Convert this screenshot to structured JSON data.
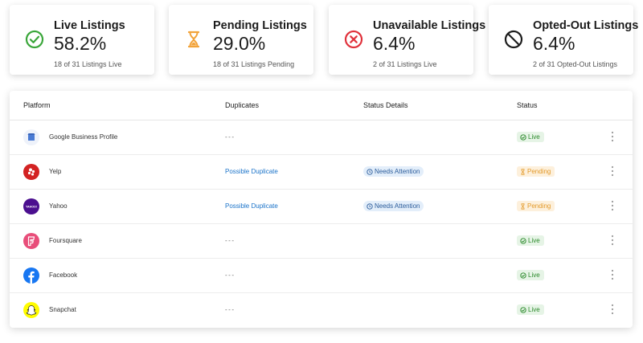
{
  "cards": [
    {
      "title": "Live Listings",
      "value": "58.2%",
      "sub": "18 of 31 Listings Live",
      "icon": "check-circle-icon",
      "color": "#3aa63a"
    },
    {
      "title": "Pending Listings",
      "value": "29.0%",
      "sub": "18 of 31 Listings Pending",
      "icon": "hourglass-icon",
      "color": "#f2a33a"
    },
    {
      "title": "Unavailable Listings",
      "value": "6.4%",
      "sub": "2 of 31 Listings Live",
      "icon": "x-circle-icon",
      "color": "#e0323c"
    },
    {
      "title": "Opted-Out Listings",
      "value": "6.4%",
      "sub": "2 of 31 Opted-Out Listings",
      "icon": "prohibited-icon",
      "color": "#1c1c1c"
    }
  ],
  "table": {
    "headers": {
      "platform": "Platform",
      "duplicates": "Duplicates",
      "status_details": "Status Details",
      "status": "Status"
    },
    "rows": [
      {
        "platform": "Google Business Profile",
        "duplicates": "---",
        "status_details": "",
        "status": "Live"
      },
      {
        "platform": "Yelp",
        "duplicates": "Possible Duplicate",
        "status_details": "Needs Attention",
        "status": "Pending"
      },
      {
        "platform": "Yahoo",
        "duplicates": "Possible Duplicate",
        "status_details": "Needs Attention",
        "status": "Pending"
      },
      {
        "platform": "Foursquare",
        "duplicates": "---",
        "status_details": "",
        "status": "Live"
      },
      {
        "platform": "Facebook",
        "duplicates": "---",
        "status_details": "",
        "status": "Live"
      },
      {
        "platform": "Snapchat",
        "duplicates": "---",
        "status_details": "",
        "status": "Live"
      }
    ],
    "yahoo_logo_text": "YAHOO!"
  }
}
